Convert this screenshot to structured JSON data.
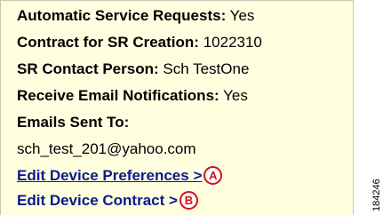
{
  "fields": {
    "auto_sr_label": "Automatic Service Requests:",
    "auto_sr_value": "Yes",
    "contract_label": "Contract for SR Creation:",
    "contract_value": "1022310",
    "contact_label": "SR Contact Person:",
    "contact_value": "Sch TestOne",
    "email_notif_label": "Receive Email Notifications:",
    "email_notif_value": "Yes",
    "emails_to_label": "Emails Sent To:",
    "emails_to_value": "sch_test_201@yahoo.com"
  },
  "links": {
    "edit_prefs": "Edit Device Preferences >",
    "edit_contract": "Edit Device Contract >"
  },
  "callouts": {
    "a": "A",
    "b": "B"
  },
  "figure_id": "184246",
  "colors": {
    "panel_bg": "#ffffe0",
    "link": "#0a1a8c",
    "callout": "#d0101a"
  }
}
